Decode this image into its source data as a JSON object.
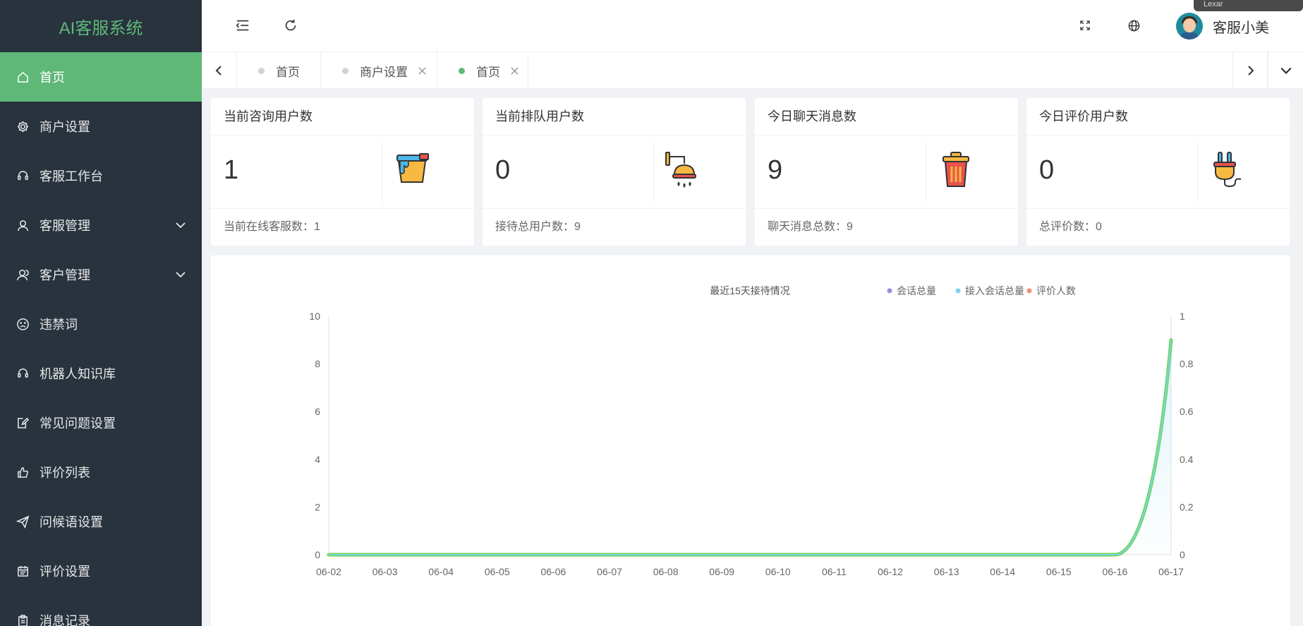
{
  "app_title": "AI客服系统",
  "sidebar": {
    "items": [
      {
        "label": "首页",
        "icon": "home-icon",
        "active": true
      },
      {
        "label": "商户设置",
        "icon": "gear-icon"
      },
      {
        "label": "客服工作台",
        "icon": "headset-icon"
      },
      {
        "label": "客服管理",
        "icon": "user-icon",
        "expandable": true
      },
      {
        "label": "客户管理",
        "icon": "users-icon",
        "expandable": true
      },
      {
        "label": "违禁词",
        "icon": "sad-face-icon"
      },
      {
        "label": "机器人知识库",
        "icon": "headset-icon"
      },
      {
        "label": "常见问题设置",
        "icon": "edit-doc-icon"
      },
      {
        "label": "评价列表",
        "icon": "thumbs-up-icon"
      },
      {
        "label": "问候语设置",
        "icon": "send-icon"
      },
      {
        "label": "评价设置",
        "icon": "calendar-icon"
      },
      {
        "label": "消息记录",
        "icon": "clipboard-icon"
      }
    ]
  },
  "header": {
    "username": "客服小美",
    "corner_text": "Lexar"
  },
  "tabs": [
    {
      "label": "首页",
      "closable": false,
      "active": false
    },
    {
      "label": "商户设置",
      "closable": true,
      "active": false
    },
    {
      "label": "首页",
      "closable": true,
      "active": true
    }
  ],
  "cards": [
    {
      "title": "当前咨询用户数",
      "value": "1",
      "footer": "当前在线客服数：1",
      "icon": "paint-bucket-icon"
    },
    {
      "title": "当前排队用户数",
      "value": "0",
      "footer": "接待总用户数：9",
      "icon": "shower-icon"
    },
    {
      "title": "今日聊天消息数",
      "value": "9",
      "footer": "聊天消息总数：9",
      "icon": "trash-icon"
    },
    {
      "title": "今日评价用户数",
      "value": "0",
      "footer": "总评价数：0",
      "icon": "plug-icon"
    }
  ],
  "chart_data": {
    "type": "line",
    "title": "最近15天接待情况",
    "categories": [
      "06-02",
      "06-03",
      "06-04",
      "06-05",
      "06-06",
      "06-07",
      "06-08",
      "06-09",
      "06-10",
      "06-11",
      "06-12",
      "06-13",
      "06-14",
      "06-15",
      "06-16",
      "06-17"
    ],
    "series": [
      {
        "name": "会话总量",
        "axis": "left",
        "values": [
          0,
          0,
          0,
          0,
          0,
          0,
          0,
          0,
          0,
          0,
          0,
          0,
          0,
          0,
          0,
          9
        ]
      },
      {
        "name": "接入会话总量",
        "axis": "left",
        "values": [
          0,
          0,
          0,
          0,
          0,
          0,
          0,
          0,
          0,
          0,
          0,
          0,
          0,
          0,
          0,
          9
        ]
      },
      {
        "name": "评价人数",
        "axis": "right",
        "values": [
          0,
          0,
          0,
          0,
          0,
          0,
          0,
          0,
          0,
          0,
          0,
          0,
          0,
          0,
          0,
          0
        ]
      }
    ],
    "legend_colors": [
      "#9a8de0",
      "#7fd0f0",
      "#f28f77"
    ],
    "ylim_left": [
      0,
      10
    ],
    "yticks_left": [
      "0",
      "2",
      "4",
      "6",
      "8",
      "10"
    ],
    "ylim_right": [
      0,
      1
    ],
    "yticks_right": [
      "0",
      "0.2",
      "0.4",
      "0.6",
      "0.8",
      "1"
    ],
    "legend_position": "top-right",
    "grid": false,
    "smooth": true
  },
  "colors": {
    "sidebar_bg": "#28333e",
    "accent": "#5fb878",
    "line_gradient_start": "#c8e6a0",
    "line_gradient_end": "#f28f77",
    "line_peak": "#6bd94a"
  }
}
